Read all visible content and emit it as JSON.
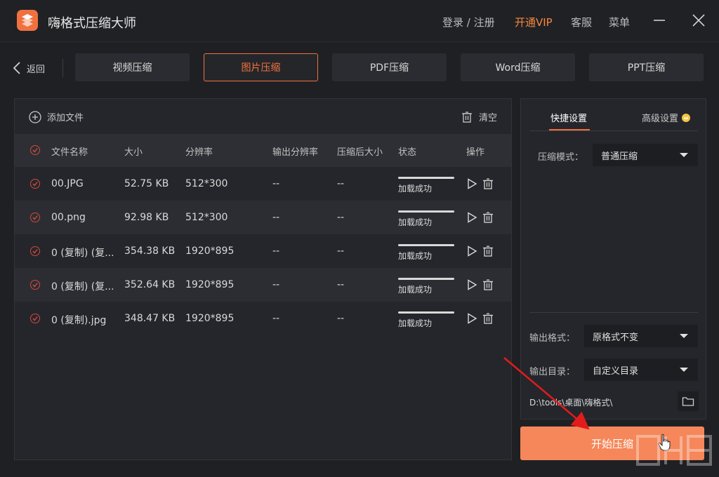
{
  "app": {
    "title": "嗨格式压缩大师",
    "menu": {
      "login": "登录 / 注册",
      "vip": "开通VIP",
      "service": "客服",
      "menu": "菜单"
    }
  },
  "nav": {
    "back": "返回",
    "tabs": [
      "视频压缩",
      "图片压缩",
      "PDF压缩",
      "Word压缩",
      "PPT压缩"
    ],
    "active_tab": "图片压缩"
  },
  "toolbar": {
    "add_file": "添加文件",
    "clear": "清空"
  },
  "table": {
    "headers": {
      "name": "文件名称",
      "size": "大小",
      "resolution": "分辨率",
      "out_resolution": "输出分辨率",
      "compressed_size": "压缩后大小",
      "status": "状态",
      "actions": "操作"
    },
    "rows": [
      {
        "name": "00.JPG",
        "size": "52.75 KB",
        "resolution": "512*300",
        "out_resolution": "--",
        "compressed_size": "--",
        "status": "加载成功",
        "progress": 1.0
      },
      {
        "name": "00.png",
        "size": "92.98 KB",
        "resolution": "512*300",
        "out_resolution": "--",
        "compressed_size": "--",
        "status": "加载成功",
        "progress": 1.0
      },
      {
        "name": "0 (复制) (复...",
        "size": "354.38 KB",
        "resolution": "1920*895",
        "out_resolution": "--",
        "compressed_size": "--",
        "status": "加载成功",
        "progress": 1.0
      },
      {
        "name": "0 (复制) (复...",
        "size": "352.64 KB",
        "resolution": "1920*895",
        "out_resolution": "--",
        "compressed_size": "--",
        "status": "加载成功",
        "progress": 1.0
      },
      {
        "name": "0 (复制).jpg",
        "size": "348.47 KB",
        "resolution": "1920*895",
        "out_resolution": "--",
        "compressed_size": "--",
        "status": "加载成功",
        "progress": 1.0
      }
    ]
  },
  "settings": {
    "tabs": {
      "quick": "快捷设置",
      "advanced": "高级设置"
    },
    "mode_label": "压缩模式：",
    "mode_value": "普通压缩",
    "format_label": "输出格式：",
    "format_value": "原格式不变",
    "dir_label": "输出目录：",
    "dir_value": "自定义目录",
    "path": "D:\\tools\\桌面\\嗨格式\\"
  },
  "start_button": "开始压缩",
  "colors": {
    "accent": "#f0713f",
    "start": "#f5875a",
    "background": "#1f2024",
    "panel": "#25262b"
  }
}
